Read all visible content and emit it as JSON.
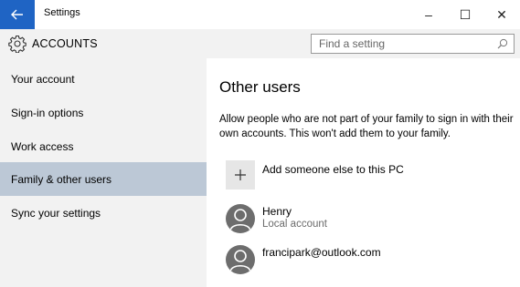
{
  "window": {
    "title": "Settings",
    "controls": {
      "minimize": "–",
      "maximize": "☐",
      "close": "✕"
    }
  },
  "header": {
    "title": "ACCOUNTS",
    "search_placeholder": "Find a setting"
  },
  "sidebar": {
    "items": [
      {
        "label": "Your account",
        "selected": false
      },
      {
        "label": "Sign-in options",
        "selected": false
      },
      {
        "label": "Work access",
        "selected": false
      },
      {
        "label": "Family & other users",
        "selected": true
      },
      {
        "label": "Sync your settings",
        "selected": false
      }
    ]
  },
  "main": {
    "title": "Other users",
    "description": "Allow people who are not part of your family to sign in with their own accounts. This won't add them to your family.",
    "add_label": "Add someone else to this PC",
    "add_symbol": "+",
    "users": [
      {
        "name": "Henry",
        "subtitle": "Local account"
      },
      {
        "name": "francipark@outlook.com",
        "subtitle": ""
      }
    ]
  },
  "colors": {
    "accent": "#1f64c4",
    "selected_nav": "#bcc8d6",
    "sidebar_bg": "#f2f2f2",
    "avatar_bg": "#6d6d6d"
  },
  "icons": {
    "back": "back-arrow-icon",
    "header": "gear-icon",
    "search": "search-icon",
    "add": "plus-icon",
    "user": "user-avatar-icon"
  }
}
